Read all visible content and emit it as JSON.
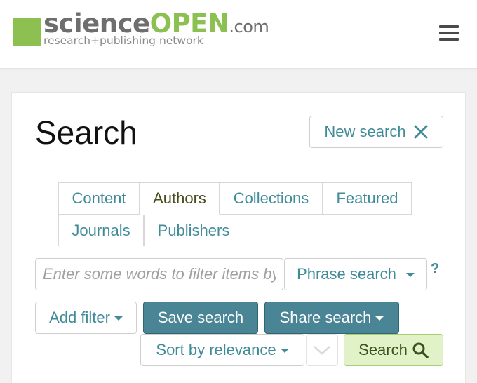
{
  "logo": {
    "science": "science",
    "open": "OPEN",
    "com": ".com",
    "tagline": "research+publishing network"
  },
  "header": {
    "menu_icon": "hamburger-icon"
  },
  "page": {
    "title": "Search",
    "new_search_label": "New search"
  },
  "tabs": [
    {
      "label": "Content",
      "active": false
    },
    {
      "label": "Authors",
      "active": true
    },
    {
      "label": "Collections",
      "active": false
    },
    {
      "label": "Featured",
      "active": false
    },
    {
      "label": "Journals",
      "active": false
    },
    {
      "label": "Publishers",
      "active": false
    }
  ],
  "filter": {
    "placeholder": "Enter some words to filter items by",
    "value": "",
    "mode_label": "Phrase search",
    "help": "?"
  },
  "actions": {
    "add_filter": "Add filter",
    "save_search": "Save search",
    "share_search": "Share search",
    "sort_label": "Sort by relevance",
    "search_label": "Search"
  },
  "colors": {
    "accent_teal": "#3f8b9a",
    "button_teal": "#4a8596",
    "brand_green": "#8cc152",
    "search_green_bg": "#e2f2c8"
  }
}
